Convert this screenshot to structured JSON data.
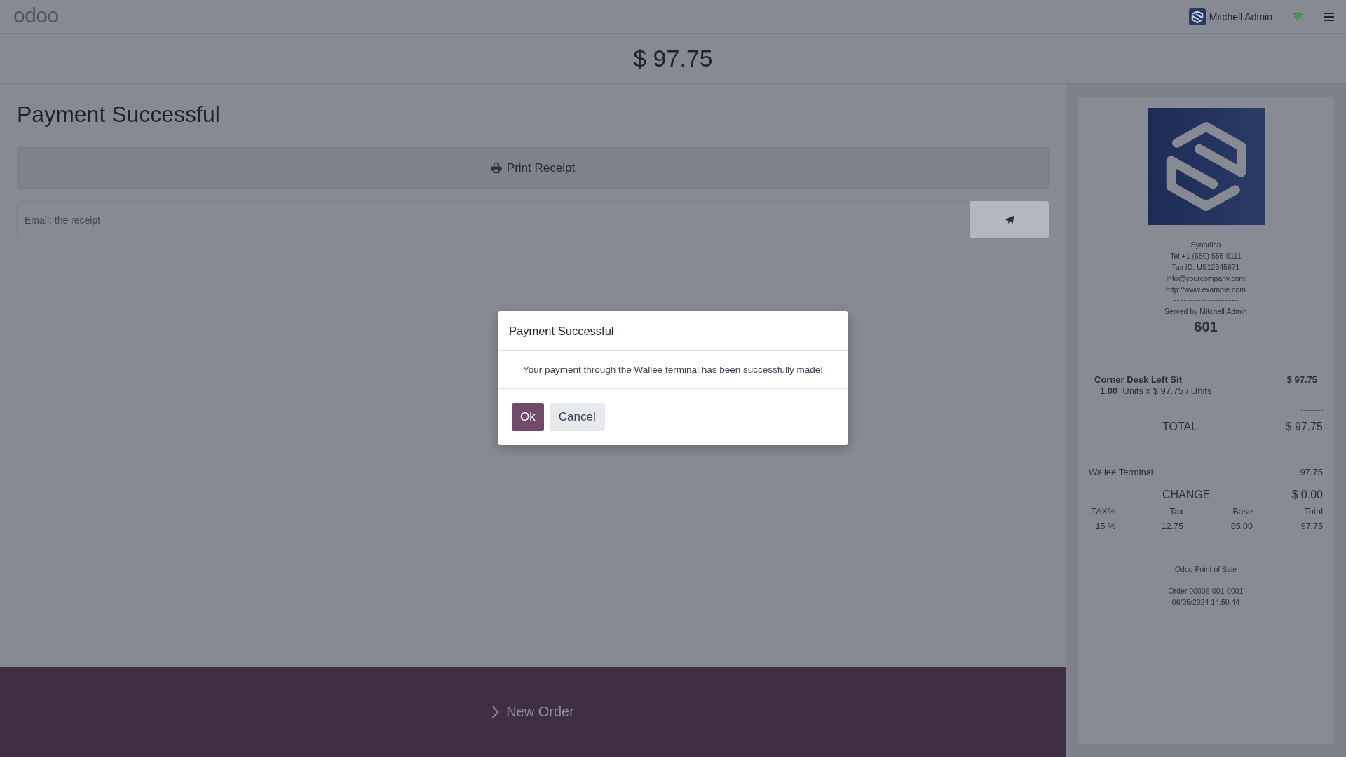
{
  "header": {
    "brand": "odoo",
    "user": {
      "name": "Mitchell Admin"
    },
    "connection": {
      "online": true
    }
  },
  "total": "$ 97.75",
  "payment": {
    "title": "Payment Successful",
    "print_button": "Print Receipt",
    "email": {
      "placeholder": "Email: the receipt"
    }
  },
  "new_order_button": "New Order",
  "receipt": {
    "company_lines": [
      "Synodica",
      "Tel:+1 (650) 555-0111",
      "Tax ID: US12345671",
      "info@yourcompany.com",
      "http://www.example.com"
    ],
    "served_by": "Served by Mitchell Admin",
    "tracking_number": "601",
    "lines": [
      {
        "product": "Corner Desk Left Sit",
        "price": "$ 97.75",
        "quantity": "1.00",
        "unit_detail": "Units x $ 97.75 / Units"
      }
    ],
    "total": {
      "label": "TOTAL",
      "amount": "$ 97.75"
    },
    "payments": [
      {
        "method": "Wallee Terminal",
        "amount": "97.75"
      }
    ],
    "change": {
      "label": "CHANGE",
      "amount": "$ 0.00"
    },
    "tax_table": {
      "columns": [
        "TAX%",
        "Tax",
        "Base",
        "Total"
      ],
      "rows": [
        [
          "15 %",
          "12.75",
          "85.00",
          "97.75"
        ]
      ]
    },
    "footer": "Odoo Point of Sale",
    "order_name": "Order 00006-001-0001",
    "date": "06/05/2024 14:50:44"
  },
  "dialog": {
    "title": "Payment Successful",
    "message": "Your payment through the Wallee terminal has been successfully made!",
    "buttons": [
      {
        "label": "Ok",
        "kind": "primary"
      },
      {
        "label": "Cancel",
        "kind": "secondary"
      }
    ]
  }
}
